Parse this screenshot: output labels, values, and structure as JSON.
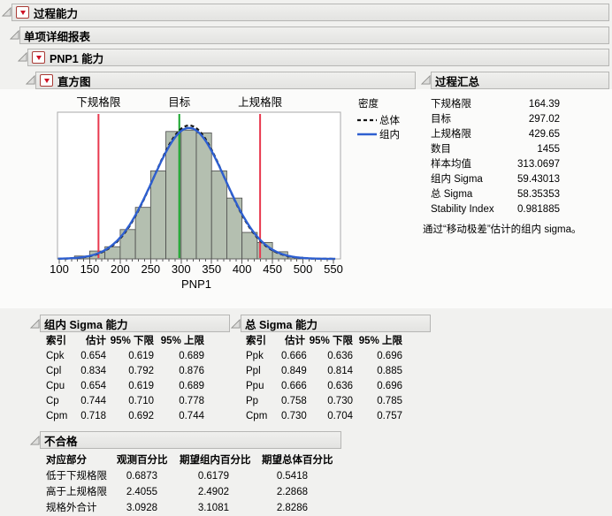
{
  "outline": {
    "l1": "过程能力",
    "l2": "单项详细报表",
    "l3": "PNP1 能力",
    "hist": "直方图",
    "summary": "过程汇总",
    "within": "组内 Sigma 能力",
    "overall": "总 Sigma 能力",
    "nonconf": "不合格"
  },
  "chart_data": {
    "type": "histogram",
    "xlabel": "PNP1",
    "xlim": [
      95,
      555
    ],
    "x_major_ticks": [
      100,
      150,
      200,
      250,
      300,
      350,
      400,
      450,
      500,
      550
    ],
    "x_minor_step": 10,
    "bin_width": 25,
    "bar_fill": "#b4bfb0",
    "bar_stroke": "#4a4a4a",
    "bars": [
      {
        "x0": 125,
        "h": 0.02
      },
      {
        "x0": 150,
        "h": 0.055
      },
      {
        "x0": 175,
        "h": 0.085
      },
      {
        "x0": 200,
        "h": 0.205
      },
      {
        "x0": 225,
        "h": 0.36
      },
      {
        "x0": 250,
        "h": 0.615
      },
      {
        "x0": 275,
        "h": 0.89
      },
      {
        "x0": 300,
        "h": 0.9
      },
      {
        "x0": 325,
        "h": 0.88
      },
      {
        "x0": 350,
        "h": 0.615
      },
      {
        "x0": 375,
        "h": 0.425
      },
      {
        "x0": 400,
        "h": 0.185
      },
      {
        "x0": 425,
        "h": 0.115
      },
      {
        "x0": 450,
        "h": 0.05
      },
      {
        "x0": 475,
        "h": 0.012
      }
    ],
    "ref_lines": [
      {
        "label": "下规格限",
        "value": 164.39,
        "color": "#e8394f"
      },
      {
        "label": "目标",
        "value": 297.02,
        "color": "#17a52b"
      },
      {
        "label": "上规格限",
        "value": 429.65,
        "color": "#e8394f"
      }
    ],
    "curves": [
      {
        "name": "总体",
        "mean": 313.0697,
        "sigma": 58.35353,
        "peak": 0.932,
        "style": "dashed",
        "color": "#141414"
      },
      {
        "name": "组内",
        "mean": 313.0697,
        "sigma": 59.43013,
        "peak": 0.915,
        "style": "solid",
        "color": "#2e5fd0"
      }
    ],
    "legend": {
      "title": "密度",
      "entries": [
        {
          "label": "总体",
          "style": "dashed",
          "color": "#141414"
        },
        {
          "label": "组内",
          "style": "solid",
          "color": "#2e5fd0"
        }
      ]
    }
  },
  "process_summary": {
    "rows": [
      [
        "下规格限",
        "164.39"
      ],
      [
        "目标",
        "297.02"
      ],
      [
        "上规格限",
        "429.65"
      ],
      [
        "数目",
        "1455"
      ],
      [
        "样本均值",
        "313.0697"
      ],
      [
        "组内 Sigma",
        "59.43013"
      ],
      [
        "总 Sigma",
        "58.35353"
      ],
      [
        "Stability Index",
        "0.981885"
      ]
    ],
    "footnote": "通过“移动极差”估计的组内 sigma。"
  },
  "within_capability": {
    "columns": [
      "索引",
      "估计",
      "95% 下限",
      "95% 上限"
    ],
    "rows": [
      [
        "Cpk",
        "0.654",
        "0.619",
        "0.689"
      ],
      [
        "Cpl",
        "0.834",
        "0.792",
        "0.876"
      ],
      [
        "Cpu",
        "0.654",
        "0.619",
        "0.689"
      ],
      [
        "Cp",
        "0.744",
        "0.710",
        "0.778"
      ],
      [
        "Cpm",
        "0.718",
        "0.692",
        "0.744"
      ]
    ]
  },
  "overall_capability": {
    "columns": [
      "索引",
      "估计",
      "95% 下限",
      "95% 上限"
    ],
    "rows": [
      [
        "Ppk",
        "0.666",
        "0.636",
        "0.696"
      ],
      [
        "Ppl",
        "0.849",
        "0.814",
        "0.885"
      ],
      [
        "Ppu",
        "0.666",
        "0.636",
        "0.696"
      ],
      [
        "Pp",
        "0.758",
        "0.730",
        "0.785"
      ],
      [
        "Cpm",
        "0.730",
        "0.704",
        "0.757"
      ]
    ]
  },
  "nonconformance": {
    "columns": [
      "对应部分",
      "观测百分比",
      "期望组内百分比",
      "期望总体百分比"
    ],
    "rows": [
      [
        "低于下规格限",
        "0.6873",
        "0.6179",
        "0.5418"
      ],
      [
        "高于上规格限",
        "2.4055",
        "2.4902",
        "2.2868"
      ],
      [
        "规格外合计",
        "3.0928",
        "3.1081",
        "2.8286"
      ]
    ]
  }
}
